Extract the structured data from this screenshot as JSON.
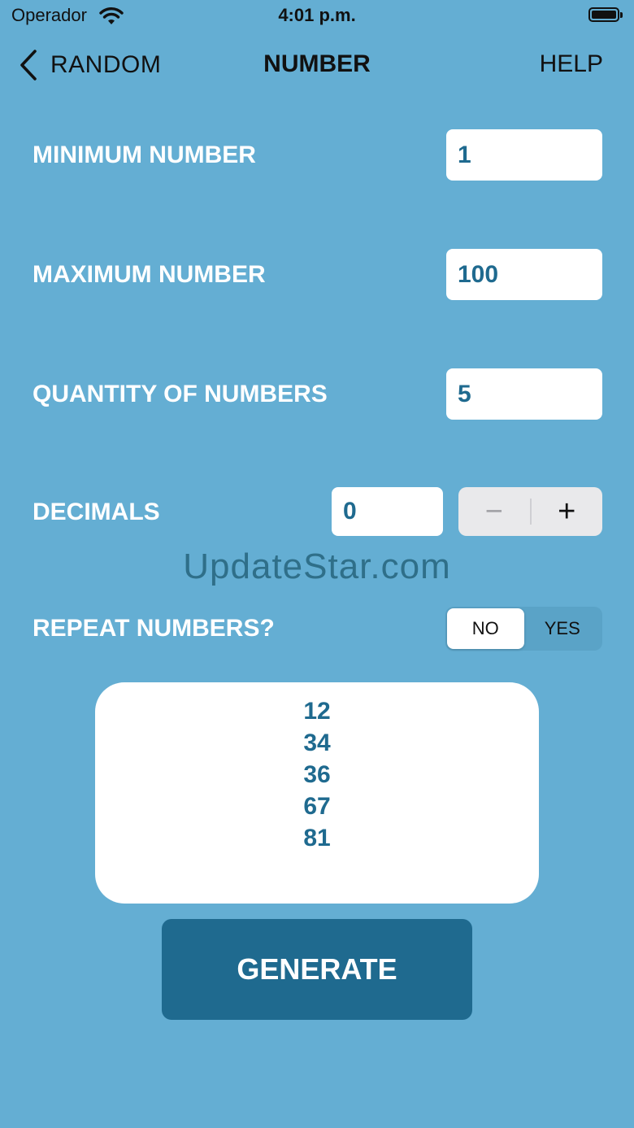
{
  "status_bar": {
    "carrier": "Operador",
    "time": "4:01 p.m.",
    "icons": [
      "wifi-icon",
      "battery-icon"
    ]
  },
  "nav": {
    "back_label": "RANDOM",
    "title": "NUMBER",
    "help_label": "HELP"
  },
  "form": {
    "minimum": {
      "label": "MINIMUM NUMBER",
      "value": "1"
    },
    "maximum": {
      "label": "MAXIMUM NUMBER",
      "value": "100"
    },
    "quantity": {
      "label": "QUANTITY OF NUMBERS",
      "value": "5"
    },
    "decimals": {
      "label": "DECIMALS",
      "value": "0",
      "minus": "−",
      "plus": "+"
    },
    "repeat": {
      "label": "REPEAT NUMBERS?",
      "options": [
        "NO",
        "YES"
      ],
      "selected": "NO"
    }
  },
  "watermark": "UpdateStar.com",
  "results": [
    "12",
    "34",
    "36",
    "67",
    "81"
  ],
  "generate_label": "GENERATE",
  "colors": {
    "background": "#64aed3",
    "accent": "#1f6a8f",
    "field_bg": "#ffffff"
  }
}
